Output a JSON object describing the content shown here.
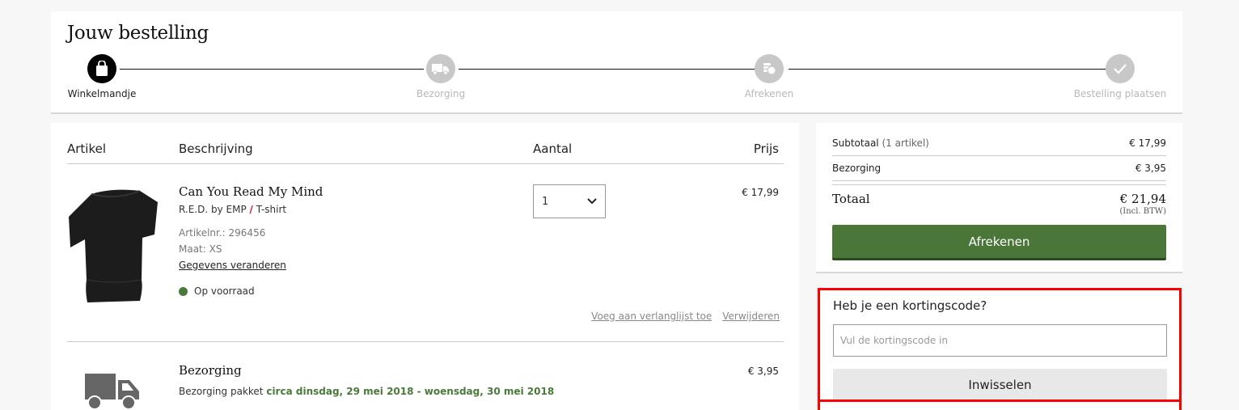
{
  "header": {
    "title": "Jouw bestelling",
    "steps": [
      {
        "label": "Winkelmandje",
        "icon": "shopping-bag-icon",
        "state": "active"
      },
      {
        "label": "Bezorging",
        "icon": "truck-icon",
        "state": "inactive"
      },
      {
        "label": "Afrekenen",
        "icon": "coins-icon",
        "state": "inactive"
      },
      {
        "label": "Bestelling plaatsen",
        "icon": "checkmark-icon",
        "state": "inactive"
      }
    ]
  },
  "cart": {
    "columns": {
      "article": "Artikel",
      "description": "Beschrijving",
      "quantity": "Aantal",
      "price": "Prijs"
    },
    "items": [
      {
        "name": "Can You Read My Mind",
        "brand": "R.E.D. by EMP",
        "separator": "/",
        "type": "T-shirt",
        "article_no": "Artikelnr.: 296456",
        "size": "Maat: XS",
        "edit_link": "Gegevens veranderen",
        "stock": "Op voorraad",
        "quantity": "1",
        "price": "€ 17,99",
        "actions": {
          "wishlist": "Voeg aan verlanglijst toe",
          "remove": "Verwijderen"
        }
      }
    ],
    "shipping": {
      "title": "Bezorging",
      "desc_prefix": "Bezorging pakket",
      "desc_dates": "circa dinsdag, 29 mei 2018 - woensdag, 30 mei 2018",
      "price": "€ 3,95"
    }
  },
  "summary": {
    "subtotal_label": "Subtotaal",
    "subtotal_count": "(1 artikel)",
    "subtotal_value": "€ 17,99",
    "shipping_label": "Bezorging",
    "shipping_value": "€ 3,95",
    "total_label": "Totaal",
    "total_value": "€ 21,94",
    "total_note": "(Incl. BTW)",
    "checkout_label": "Afrekenen"
  },
  "coupon": {
    "title": "Heb je een kortingscode?",
    "placeholder": "Vul de kortingscode in",
    "value": "",
    "redeem_label": "Inwisselen"
  },
  "colors": {
    "accent_green": "#4a763a",
    "stock_green": "#4a7a3a",
    "highlight_red": "#ff0000",
    "brand_slash": "#c8102e"
  }
}
